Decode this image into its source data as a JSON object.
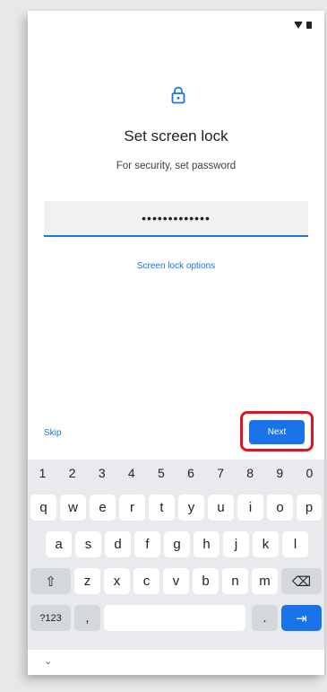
{
  "lock": {
    "title": "Set screen lock",
    "subtitle": "For security, set password"
  },
  "password_field": {
    "value": "•••••••••••••"
  },
  "screen_lock_options": "Screen lock options",
  "actions": {
    "skip": "Skip",
    "next": "Next"
  },
  "keyboard": {
    "numbers": [
      "1",
      "2",
      "3",
      "4",
      "5",
      "6",
      "7",
      "8",
      "9",
      "0"
    ],
    "row1": [
      "q",
      "w",
      "e",
      "r",
      "t",
      "y",
      "u",
      "i",
      "o",
      "p"
    ],
    "row2": [
      "a",
      "s",
      "d",
      "f",
      "g",
      "h",
      "j",
      "k",
      "l"
    ],
    "row3": [
      "z",
      "x",
      "c",
      "v",
      "b",
      "n",
      "m"
    ],
    "shift": "⇧",
    "backspace": "⌫",
    "symbols": "?123",
    "comma": ",",
    "period": ".",
    "enter": "⇥"
  },
  "nav": {
    "hide_keyboard": "⌄"
  },
  "colors": {
    "accent": "#1a73e8",
    "highlight": "#e0141e"
  }
}
